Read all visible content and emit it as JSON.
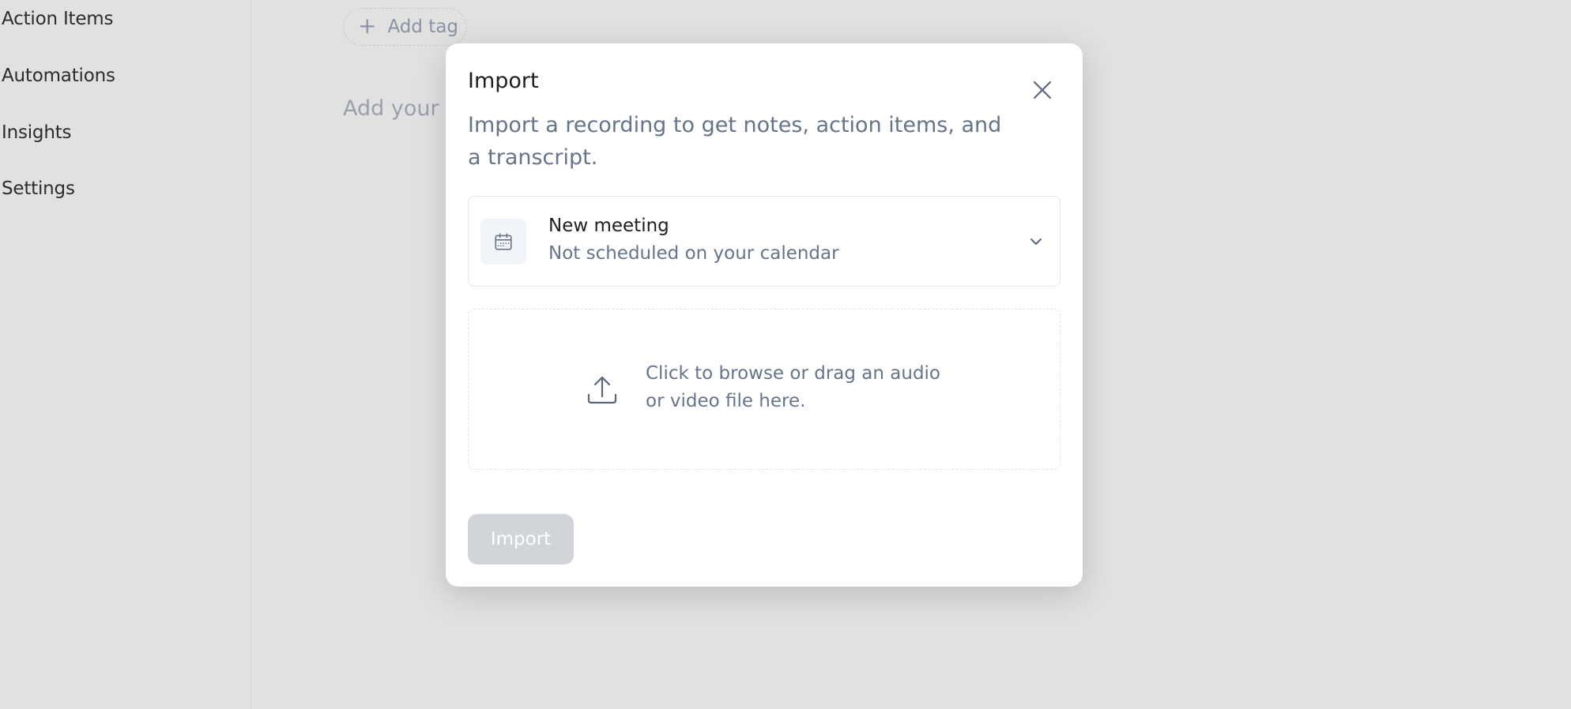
{
  "sidebar": {
    "items": [
      {
        "label": "Action Items"
      },
      {
        "label": "Automations"
      },
      {
        "label": "Insights"
      },
      {
        "label": "Settings"
      }
    ]
  },
  "background": {
    "add_tag_label": "Add tag",
    "placeholder_text": "Add your c"
  },
  "modal": {
    "title": "Import",
    "description": "Import a recording to get notes, action items, and a transcript.",
    "meeting_select": {
      "title": "New meeting",
      "subtitle": "Not scheduled on your calendar",
      "icon": "calendar-icon"
    },
    "dropzone": {
      "text": "Click to browse or drag an audio or video file here.",
      "icon": "upload-icon"
    },
    "import_button": {
      "label": "Import",
      "disabled": true
    }
  },
  "colors": {
    "backdrop": "#e1e1e1",
    "muted_text": "#66748a",
    "disabled_button": "#d1d5da"
  }
}
